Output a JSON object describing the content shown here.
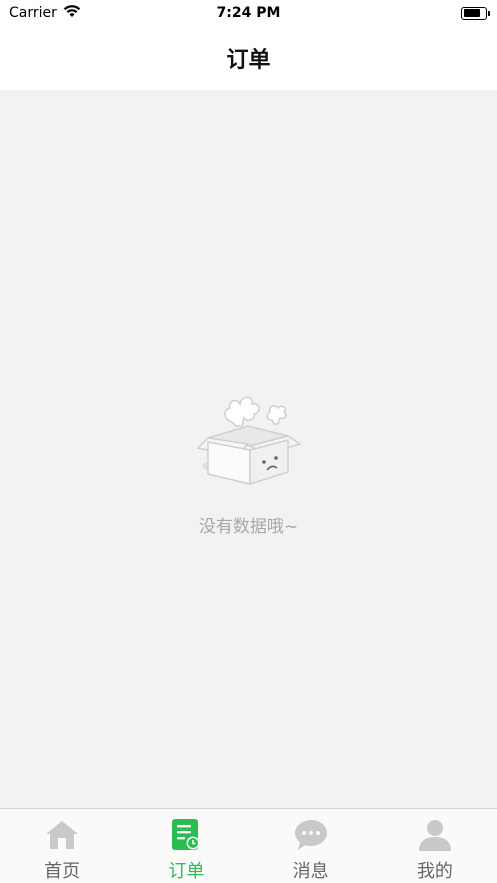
{
  "status_bar": {
    "carrier": "Carrier",
    "time": "7:24 PM",
    "battery_level": 0.8
  },
  "nav": {
    "title": "订单"
  },
  "empty_state": {
    "message": "没有数据哦~",
    "icon": "empty-box-icon"
  },
  "tab_bar": {
    "active_index": 1,
    "tabs": [
      {
        "label": "首页",
        "icon": "home-icon"
      },
      {
        "label": "订单",
        "icon": "order-icon"
      },
      {
        "label": "消息",
        "icon": "message-icon"
      },
      {
        "label": "我的",
        "icon": "profile-icon"
      }
    ]
  },
  "colors": {
    "accent": "#2bbd4f",
    "inactive_icon": "#c9c9c9",
    "content_bg": "#f2f2f2",
    "empty_text": "#a8a8a8"
  }
}
